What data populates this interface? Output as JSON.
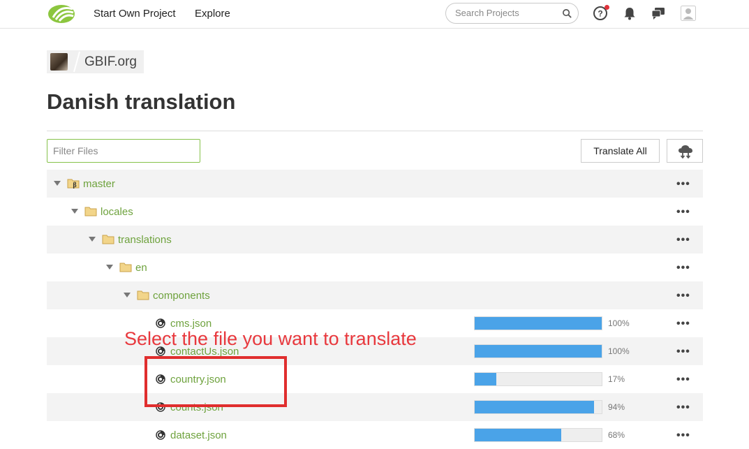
{
  "nav": {
    "start_project": "Start Own Project",
    "explore": "Explore",
    "search_placeholder": "Search Projects"
  },
  "breadcrumb": {
    "org": "GBIF.org"
  },
  "page": {
    "title": "Danish translation"
  },
  "toolbar": {
    "filter_placeholder": "Filter Files",
    "translate_all": "Translate All"
  },
  "tree": [
    {
      "label": "master",
      "type": "branch",
      "depth": 0,
      "percent": null
    },
    {
      "label": "locales",
      "type": "folder",
      "depth": 1,
      "percent": null
    },
    {
      "label": "translations",
      "type": "folder",
      "depth": 2,
      "percent": null
    },
    {
      "label": "en",
      "type": "folder",
      "depth": 3,
      "percent": null
    },
    {
      "label": "components",
      "type": "folder",
      "depth": 4,
      "percent": null
    },
    {
      "label": "cms.json",
      "type": "file",
      "depth": 5,
      "percent": "100%",
      "progress": 100
    },
    {
      "label": "contactUs.json",
      "type": "file",
      "depth": 5,
      "percent": "100%",
      "progress": 100
    },
    {
      "label": "country.json",
      "type": "file",
      "depth": 5,
      "percent": "17%",
      "progress": 17
    },
    {
      "label": "counts.json",
      "type": "file",
      "depth": 5,
      "percent": "94%",
      "progress": 94
    },
    {
      "label": "dataset.json",
      "type": "file",
      "depth": 5,
      "percent": "68%",
      "progress": 68
    }
  ],
  "annotation": {
    "text": "Select the file you want to translate"
  },
  "colors": {
    "accent_green": "#6ea23d",
    "progress_blue": "#4aa3e8",
    "annotation_red": "#e8383d"
  }
}
